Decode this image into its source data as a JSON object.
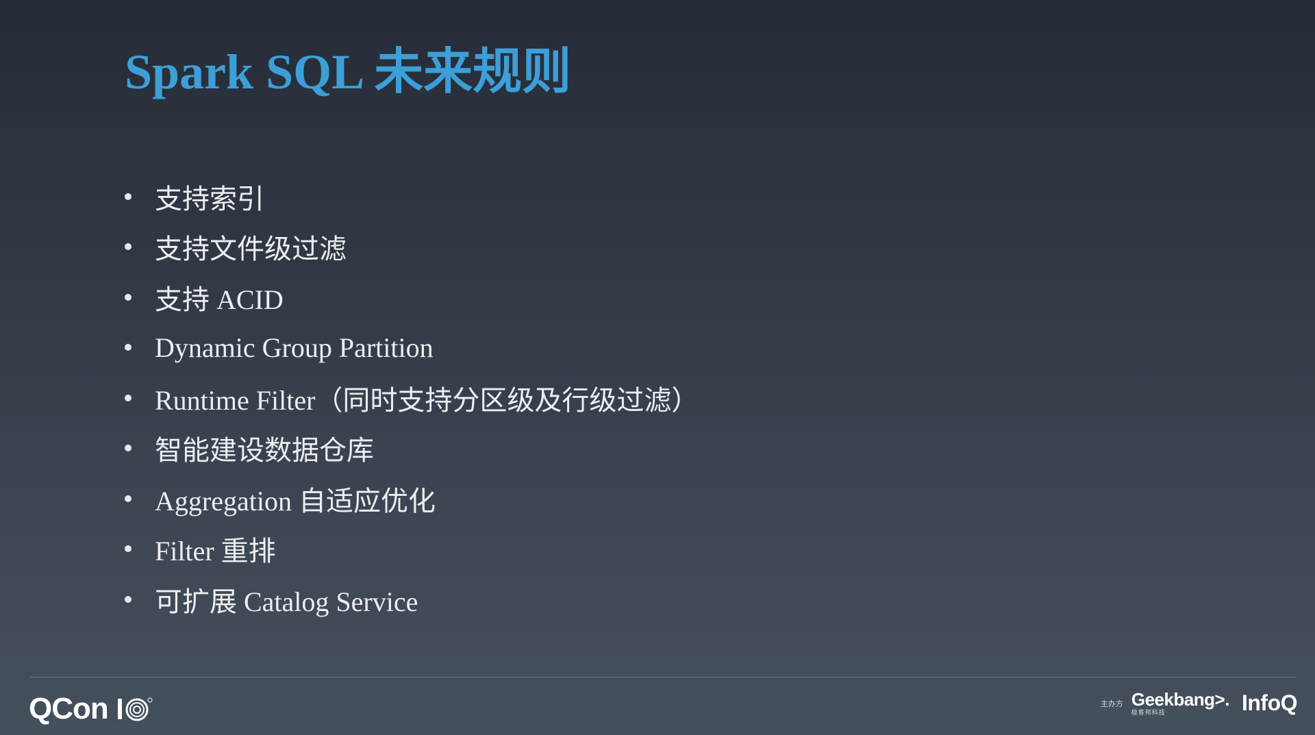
{
  "slide": {
    "title": "Spark SQL 未来规则",
    "bullets": [
      "支持索引",
      "支持文件级过滤",
      "支持 ACID",
      "Dynamic Group Partition",
      "Runtime Filter（同时支持分区级及行级过滤）",
      "智能建设数据仓库",
      "Aggregation 自适应优化",
      "Filter 重排",
      "可扩展 Catalog Service"
    ]
  },
  "footer": {
    "left_logo_text": "QCon",
    "sponsor_label": "主办方",
    "sponsor_logo_text": "Geekbang>.",
    "sponsor_logo_subtext": "极客邦科技",
    "partner_logo_text": "InfoQ"
  },
  "colors": {
    "title": "#3c9fd8",
    "text": "#eceef1",
    "background_top": "#262c37",
    "background_bottom": "#45505d"
  }
}
